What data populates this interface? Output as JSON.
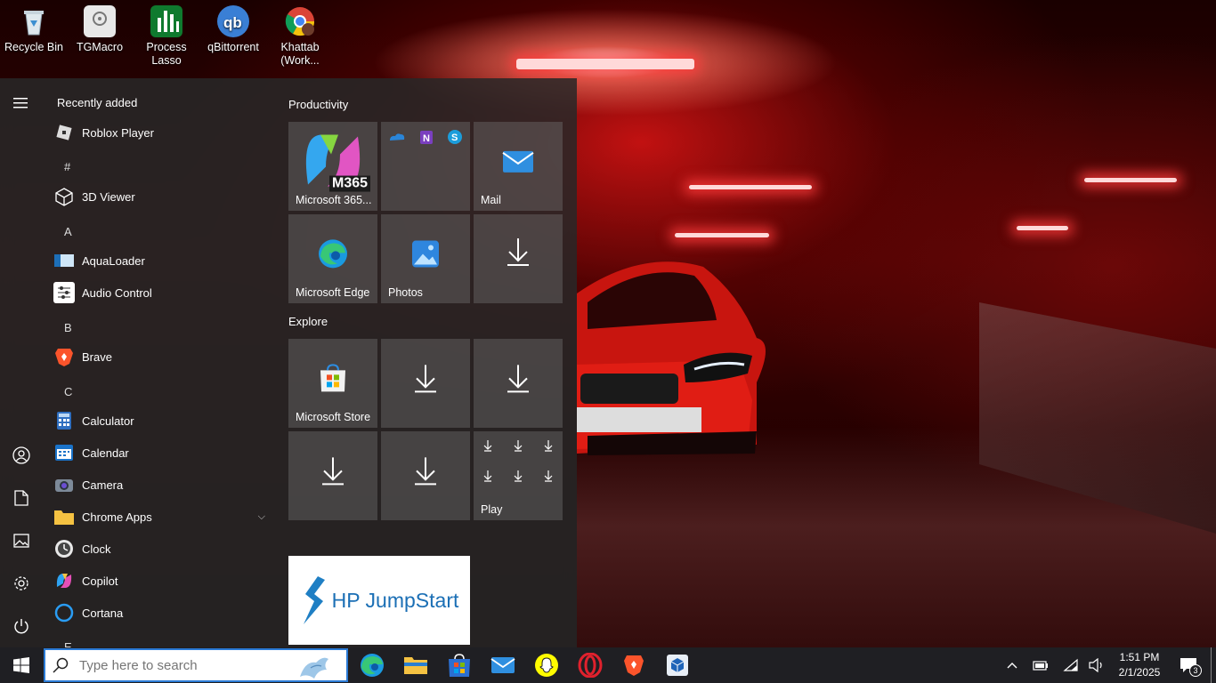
{
  "desktop": {
    "icons": [
      {
        "label": "Recycle Bin"
      },
      {
        "label": "TGMacro"
      },
      {
        "label": "Process Lasso"
      },
      {
        "label": "qBittorrent"
      },
      {
        "label": "Khattab (Work..."
      }
    ]
  },
  "start_menu": {
    "recently_added_header": "Recently added",
    "apps": [
      {
        "label": "Roblox Player"
      },
      {
        "letter": "#"
      },
      {
        "label": "3D Viewer"
      },
      {
        "letter": "A"
      },
      {
        "label": "AquaLoader"
      },
      {
        "label": "Audio Control"
      },
      {
        "letter": "B"
      },
      {
        "label": "Brave"
      },
      {
        "letter": "C"
      },
      {
        "label": "Calculator"
      },
      {
        "label": "Calendar"
      },
      {
        "label": "Camera"
      },
      {
        "label": "Chrome Apps"
      },
      {
        "label": "Clock"
      },
      {
        "label": "Copilot"
      },
      {
        "label": "Cortana"
      },
      {
        "letter": "E"
      }
    ],
    "groups": {
      "productivity": "Productivity",
      "explore": "Explore"
    },
    "tiles": {
      "m365": "Microsoft 365...",
      "m365_badge": "M365",
      "mail": "Mail",
      "edge": "Microsoft Edge",
      "photos": "Photos",
      "store": "Microsoft Store",
      "play": "Play",
      "hp": "HP JumpStart"
    }
  },
  "taskbar": {
    "search_placeholder": "Type here to search",
    "time": "1:51 PM",
    "date": "2/1/2025",
    "notification_count": "3"
  }
}
